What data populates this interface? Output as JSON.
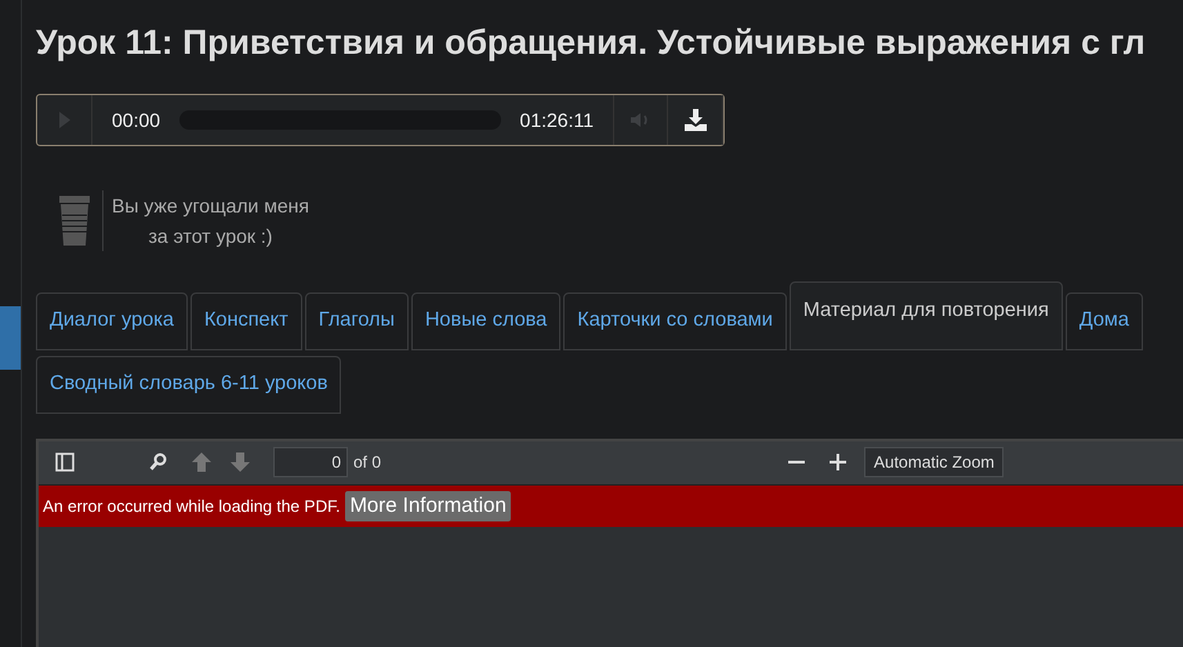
{
  "title": "Урок 11: Приветствия и обращения. Устойчивые выражения с гл",
  "audio": {
    "current_time": "00:00",
    "duration": "01:26:11"
  },
  "treat": {
    "lines": [
      "Вы уже угощали меня",
      "за этот урок :)"
    ]
  },
  "tabs": [
    {
      "label": "Диалог урока",
      "selected": false
    },
    {
      "label": "Конспект",
      "selected": false
    },
    {
      "label": "Глаголы",
      "selected": false
    },
    {
      "label": "Новые слова",
      "selected": false
    },
    {
      "label": "Карточки со словами",
      "selected": false
    },
    {
      "label": "Материал для повторения",
      "selected": true
    },
    {
      "label": "Дома",
      "selected": false
    },
    {
      "label": "Сводный словарь 6-11 уроков",
      "selected": false
    }
  ],
  "pdf_viewer": {
    "page": "0",
    "page_count": "of 0",
    "zoom": "Automatic Zoom",
    "error": "An error occurred while loading the PDF.",
    "error_button": "More Information"
  }
}
